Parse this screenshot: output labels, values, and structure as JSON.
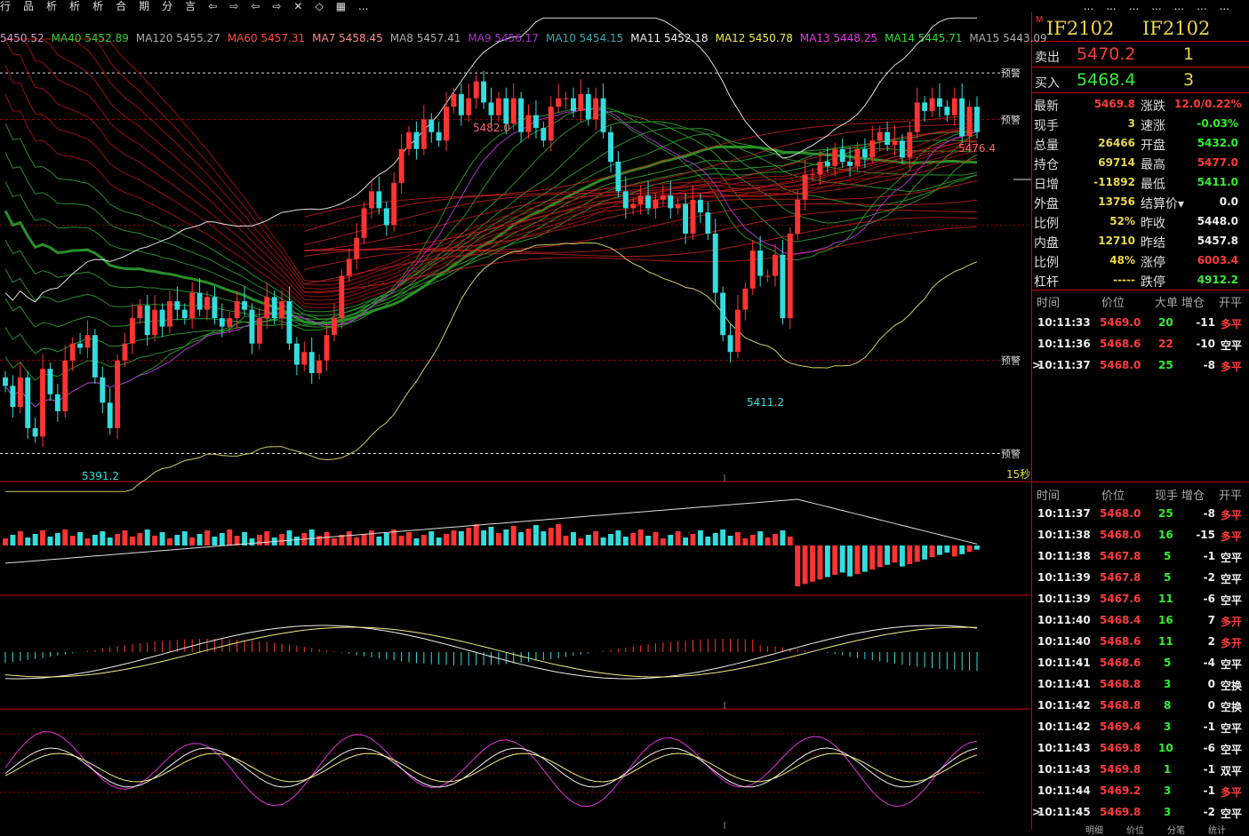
{
  "menubar": {
    "left_items": [
      "行",
      "品",
      "析",
      "析",
      "析",
      "合",
      "期",
      "分",
      "言",
      "⇦",
      "⇨",
      "⇦",
      "⇨",
      "✕",
      "◇",
      "▦",
      "..."
    ],
    "right_items": [
      "...",
      "...",
      "...",
      "...",
      "...",
      "...",
      "..."
    ]
  },
  "ma_legend": [
    {
      "label": "5450.52",
      "color": "#c9c"
    },
    {
      "label": "MA40 5452.89",
      "color": "#3c3"
    },
    {
      "label": "MA120 5455.27",
      "color": "#aaa"
    },
    {
      "label": "MA60 5457.31",
      "color": "#f44"
    },
    {
      "label": "MA7 5458.45",
      "color": "#f88"
    },
    {
      "label": "MA8 5457.41",
      "color": "#aaa"
    },
    {
      "label": "MA9 5456.17",
      "color": "#a3c"
    },
    {
      "label": "MA10 5454.15",
      "color": "#3aa"
    },
    {
      "label": "MA11 5452.18",
      "color": "#eee"
    },
    {
      "label": "MA12 5450.78",
      "color": "#ee4"
    },
    {
      "label": "MA13 5448.25",
      "color": "#e3e"
    },
    {
      "label": "MA14 5445.71",
      "color": "#3d3"
    },
    {
      "label": "MA15 5443.09",
      "color": "#aaa"
    }
  ],
  "chart_labels": {
    "alert": "预警",
    "high_label": "5482.0",
    "right_high_label": "5476.4",
    "low_label": "5411.2",
    "left_low_label": "5391.2",
    "period": "15秒"
  },
  "colors": {
    "up": "#ff3333",
    "down": "#33dddd",
    "yellow": "#e8d84b",
    "green_text": "#33ee33",
    "red_text": "#ff3a3a",
    "grid": "#c00000"
  },
  "panel": {
    "code_marker": "M",
    "code1": "IF2102",
    "code2": "IF2102",
    "sell": {
      "label": "卖出",
      "price": "5470.2",
      "qty": "1"
    },
    "buy": {
      "label": "买入",
      "price": "5468.4",
      "qty": "3"
    },
    "quote_rows": [
      {
        "l1": "最新",
        "v1": "5469.8",
        "c1": "r",
        "l2": "涨跌",
        "v2": "12.0/0.22%",
        "c2": "r"
      },
      {
        "l1": "现手",
        "v1": "3",
        "c1": "y",
        "l2": "速涨",
        "v2": "-0.03%",
        "c2": "g"
      },
      {
        "l1": "总量",
        "v1": "26466",
        "c1": "y",
        "l2": "开盘",
        "v2": "5432.0",
        "c2": "g"
      },
      {
        "l1": "持仓",
        "v1": "69714",
        "c1": "y",
        "l2": "最高",
        "v2": "5477.0",
        "c2": "r"
      },
      {
        "l1": "日增",
        "v1": "-11892",
        "c1": "y",
        "l2": "最低",
        "v2": "5411.0",
        "c2": "g"
      },
      {
        "l1": "外盘",
        "v1": "13756",
        "c1": "y",
        "l2": "结算价▾",
        "v2": "0.0",
        "c2": "w"
      },
      {
        "l1": "比例",
        "v1": "52%",
        "c1": "y",
        "l2": "昨收",
        "v2": "5448.0",
        "c2": "w"
      },
      {
        "l1": "内盘",
        "v1": "12710",
        "c1": "y",
        "l2": "昨结",
        "v2": "5457.8",
        "c2": "w"
      },
      {
        "l1": "比例",
        "v1": "48%",
        "c1": "y",
        "l2": "涨停",
        "v2": "6003.4",
        "c2": "r"
      },
      {
        "l1": "杠杆",
        "v1": "-----",
        "c1": "y",
        "l2": "跌停",
        "v2": "4912.2",
        "c2": "g"
      }
    ],
    "table_header": {
      "time": "时间",
      "price": "价位",
      "big": "大单",
      "inc": "增仓",
      "type": "开平"
    },
    "top_ticks": [
      {
        "time": "10:11:33",
        "price": "5469.0",
        "vol": "20",
        "inc": "-11",
        "type": "多平",
        "marker": ""
      },
      {
        "time": "10:11:36",
        "price": "5468.6",
        "vol": "22",
        "inc": "-10",
        "type": "空平",
        "marker": ""
      },
      {
        "time": "10:11:37",
        "price": "5468.0",
        "vol": "25",
        "inc": "-8",
        "type": "多平",
        "marker": ">"
      }
    ],
    "table2_header": {
      "time": "时间",
      "price": "价位",
      "vol": "现手",
      "inc": "增仓",
      "type": "开平"
    },
    "ticks": [
      {
        "time": "10:11:37",
        "price": "5468.0",
        "vol": "25",
        "inc": "-8",
        "type": "多平",
        "marker": ""
      },
      {
        "time": "10:11:38",
        "price": "5468.0",
        "vol": "16",
        "inc": "-15",
        "type": "多平",
        "marker": ""
      },
      {
        "time": "10:11:38",
        "price": "5467.8",
        "vol": "5",
        "inc": "-1",
        "type": "空平",
        "marker": ""
      },
      {
        "time": "10:11:39",
        "price": "5467.8",
        "vol": "5",
        "inc": "-2",
        "type": "空平",
        "marker": ""
      },
      {
        "time": "10:11:39",
        "price": "5467.6",
        "vol": "11",
        "inc": "-6",
        "type": "空平",
        "marker": ""
      },
      {
        "time": "10:11:40",
        "price": "5468.4",
        "vol": "16",
        "inc": "7",
        "type": "多开",
        "marker": ""
      },
      {
        "time": "10:11:40",
        "price": "5468.6",
        "vol": "11",
        "inc": "2",
        "type": "多开",
        "marker": ""
      },
      {
        "time": "10:11:41",
        "price": "5468.6",
        "vol": "5",
        "inc": "-4",
        "type": "空平",
        "marker": ""
      },
      {
        "time": "10:11:41",
        "price": "5468.8",
        "vol": "3",
        "inc": "0",
        "type": "空换",
        "marker": ""
      },
      {
        "time": "10:11:42",
        "price": "5468.8",
        "vol": "8",
        "inc": "0",
        "type": "空换",
        "marker": ""
      },
      {
        "time": "10:11:42",
        "price": "5469.4",
        "vol": "3",
        "inc": "-1",
        "type": "空平",
        "marker": ""
      },
      {
        "time": "10:11:43",
        "price": "5469.8",
        "vol": "10",
        "inc": "-6",
        "type": "空平",
        "marker": ""
      },
      {
        "time": "10:11:43",
        "price": "5469.8",
        "vol": "1",
        "inc": "-1",
        "type": "双平",
        "marker": ""
      },
      {
        "time": "10:11:44",
        "price": "5469.2",
        "vol": "3",
        "inc": "-1",
        "type": "多平",
        "marker": ""
      },
      {
        "time": "10:11:45",
        "price": "5469.8",
        "vol": "3",
        "inc": "-2",
        "type": "空平",
        "marker": ">"
      }
    ],
    "bottom_tabs": [
      "明细",
      "价位",
      "分笔",
      "统计"
    ]
  },
  "chart_data": {
    "type": "candlestick",
    "price_range": [
      5388,
      5492
    ],
    "alert_levels": [
      5484,
      5473,
      5416,
      5394
    ],
    "closes": [
      5410,
      5405,
      5412,
      5400,
      5398,
      5414,
      5408,
      5404,
      5416,
      5420,
      5419,
      5422,
      5412,
      5406,
      5400,
      5416,
      5420,
      5426,
      5429,
      5422,
      5428,
      5424,
      5430,
      5428,
      5426,
      5432,
      5428,
      5431,
      5426,
      5424,
      5426,
      5430,
      5428,
      5420,
      5426,
      5431,
      5426,
      5430,
      5420,
      5415,
      5418,
      5413,
      5416,
      5422,
      5426,
      5436,
      5440,
      5445,
      5452,
      5456,
      5452,
      5448,
      5458,
      5466,
      5470,
      5466,
      5473,
      5470,
      5468,
      5476,
      5479,
      5474,
      5478,
      5482,
      5477,
      5474,
      5478,
      5472,
      5478,
      5470,
      5474,
      5471,
      5468,
      5476,
      5478,
      5478,
      5475,
      5479,
      5473,
      5478,
      5470,
      5463,
      5456,
      5452,
      5453,
      5455,
      5452,
      5454,
      5455,
      5452,
      5453,
      5446,
      5454,
      5451,
      5446,
      5432,
      5422,
      5418,
      5428,
      5433,
      5442,
      5436,
      5436,
      5441,
      5426,
      5446,
      5454,
      5460,
      5460,
      5463,
      5462,
      5466,
      5463,
      5462,
      5466,
      5464,
      5468,
      5470,
      5467,
      5468,
      5464,
      5470,
      5477,
      5475,
      5478,
      5476,
      5474,
      5478,
      5469,
      5476,
      5470
    ],
    "ma_lines": 13,
    "volume_separator_index": 106,
    "macd_range": [
      -1,
      1
    ],
    "kdj_range": [
      0,
      100
    ]
  }
}
